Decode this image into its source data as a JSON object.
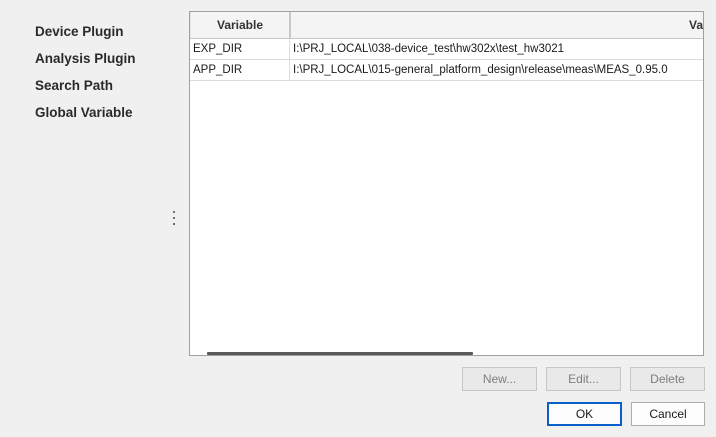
{
  "sidebar": {
    "items": [
      {
        "label": "Device Plugin"
      },
      {
        "label": "Analysis Plugin"
      },
      {
        "label": "Search Path"
      },
      {
        "label": "Global Variable"
      }
    ]
  },
  "table": {
    "columns": {
      "variable": "Variable",
      "value": "Va"
    },
    "rows": [
      {
        "variable": "EXP_DIR",
        "value": "I:\\PRJ_LOCAL\\038-device_test\\hw302x\\test_hw3021"
      },
      {
        "variable": "APP_DIR",
        "value": "I:\\PRJ_LOCAL\\015-general_platform_design\\release\\meas\\MEAS_0.95.0"
      }
    ]
  },
  "actions": {
    "new_label": "New...",
    "edit_label": "Edit...",
    "delete_label": "Delete"
  },
  "dialog": {
    "ok_label": "OK",
    "cancel_label": "Cancel"
  },
  "colors": {
    "background": "#f0f0f0",
    "default_button_border": "#0a60c9",
    "disabled_text": "#7d7d7d"
  }
}
